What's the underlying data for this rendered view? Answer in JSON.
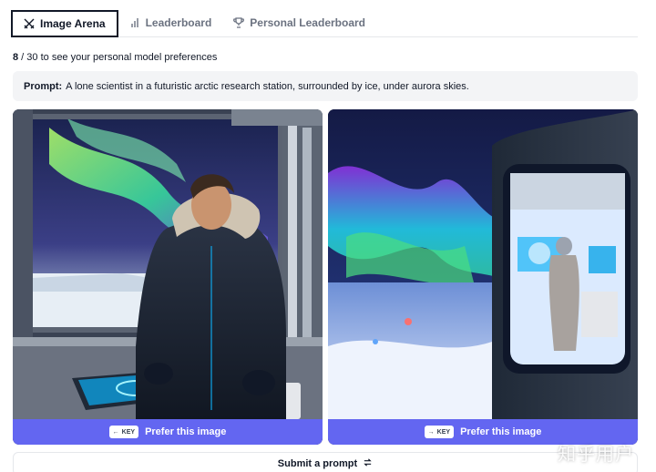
{
  "tabs": [
    {
      "label": "Image Arena",
      "icon": "swords-icon",
      "active": true
    },
    {
      "label": "Leaderboard",
      "icon": "bar-chart-icon",
      "active": false
    },
    {
      "label": "Personal Leaderboard",
      "icon": "trophy-icon",
      "active": false
    }
  ],
  "progress": {
    "current": "8",
    "rest": " / 30 to see your personal model preferences"
  },
  "prompt": {
    "label": "Prompt:",
    "text": "A lone scientist in a futuristic arctic research station, surrounded by ice, under aurora skies."
  },
  "choices": {
    "left": {
      "key": "KEY",
      "label": "Prefer this image"
    },
    "right": {
      "key": "KEY",
      "label": "Prefer this image"
    }
  },
  "submit": {
    "label": "Submit a prompt"
  },
  "watermark": "知乎用户",
  "colors": {
    "accent": "#6366f1",
    "prompt_bg": "#f3f4f6"
  }
}
